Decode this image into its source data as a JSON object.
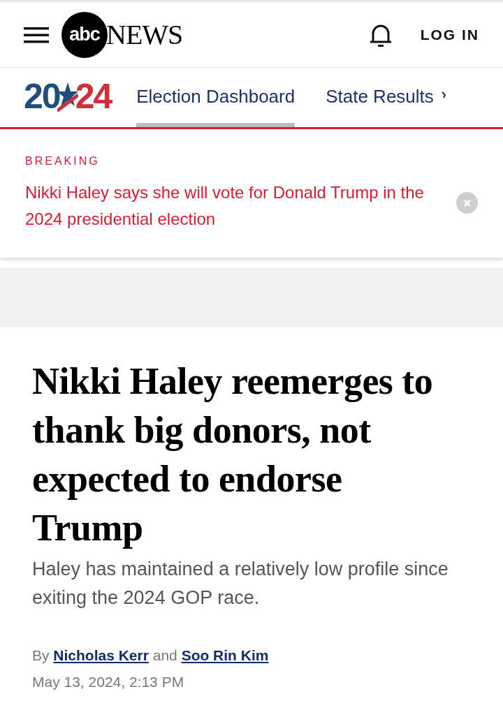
{
  "header": {
    "logo_mark": "abc",
    "logo_word": "NEWS",
    "login": "LOG IN"
  },
  "election_nav": {
    "logo_parts": [
      "20",
      "24"
    ],
    "tabs": [
      {
        "label": "Election Dashboard",
        "selected": true
      },
      {
        "label": "State Results",
        "selected": false
      }
    ]
  },
  "breaking": {
    "label": "BREAKING",
    "text": "Nikki Haley says she will vote for Donald Trump in the 2024 presidential election"
  },
  "article": {
    "headline": "Nikki Haley reemerges to thank big donors, not expected to endorse Trump",
    "subhead": "Haley has maintained a relatively low profile since exiting the 2024 GOP race.",
    "byline": {
      "prefix": "By",
      "authors": [
        "Nicholas Kerr",
        "Soo Rin Kim"
      ],
      "joiner": "and"
    },
    "date": "May 13, 2024, 2:13 PM"
  }
}
